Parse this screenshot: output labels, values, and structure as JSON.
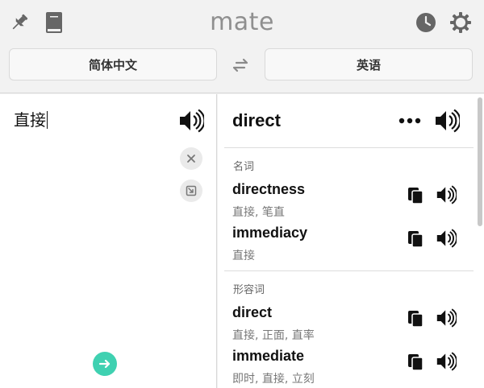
{
  "app": {
    "title": "mate"
  },
  "languages": {
    "source": "简体中文",
    "target": "英语"
  },
  "input": {
    "text": "直接"
  },
  "result": {
    "headword": "direct",
    "sections": [
      {
        "pos": "名词",
        "entries": [
          {
            "word": "directness",
            "translation": "直接, 笔直"
          },
          {
            "word": "immediacy",
            "translation": "直接"
          }
        ]
      },
      {
        "pos": "形容词",
        "entries": [
          {
            "word": "direct",
            "translation": "直接, 正面, 直率"
          },
          {
            "word": "immediate",
            "translation": "即时, 直接, 立刻"
          }
        ]
      }
    ]
  },
  "colors": {
    "accent": "#3fd1b1",
    "icon": "#666666",
    "title": "#8f8f8f"
  },
  "icons": [
    "pin-icon",
    "book-icon",
    "history-icon",
    "settings-icon",
    "swap-icon",
    "speaker-icon",
    "clear-icon",
    "paste-icon",
    "arrow-right-icon",
    "more-icon",
    "copy-icon"
  ]
}
